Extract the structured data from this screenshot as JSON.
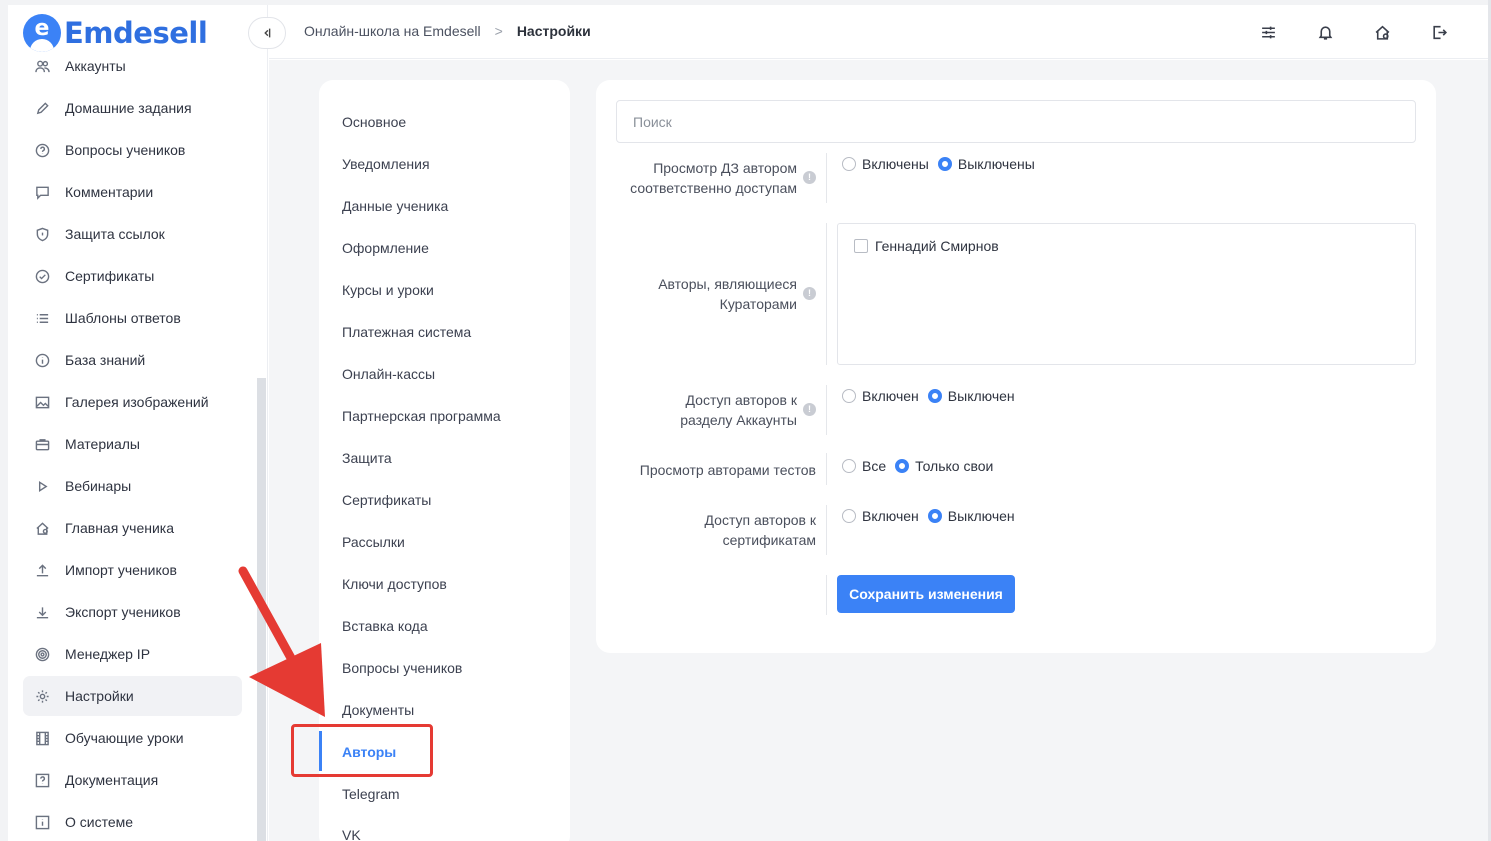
{
  "app": {
    "logo_text": "Emdesell"
  },
  "sidebar": {
    "items": [
      {
        "label": "Аккаунты",
        "icon": "users-icon"
      },
      {
        "label": "Домашние задания",
        "icon": "pencil-icon"
      },
      {
        "label": "Вопросы учеников",
        "icon": "question-circle-icon"
      },
      {
        "label": "Комментарии",
        "icon": "comment-icon"
      },
      {
        "label": "Защита ссылок",
        "icon": "shield-icon"
      },
      {
        "label": "Сертификаты",
        "icon": "check-circle-icon"
      },
      {
        "label": "Шаблоны ответов",
        "icon": "list-icon"
      },
      {
        "label": "База знаний",
        "icon": "info-circle-icon"
      },
      {
        "label": "Галерея изображений",
        "icon": "image-icon"
      },
      {
        "label": "Материалы",
        "icon": "briefcase-icon"
      },
      {
        "label": "Вебинары",
        "icon": "play-icon"
      },
      {
        "label": "Главная ученика",
        "icon": "home-icon"
      },
      {
        "label": "Импорт учеников",
        "icon": "upload-icon"
      },
      {
        "label": "Экспорт учеников",
        "icon": "download-icon"
      },
      {
        "label": "Менеджер IP",
        "icon": "target-icon"
      },
      {
        "label": "Настройки",
        "icon": "gear-icon",
        "active": true
      },
      {
        "label": "Обучающие уроки",
        "icon": "film-icon"
      },
      {
        "label": "Документация",
        "icon": "help-box-icon"
      },
      {
        "label": "О системе",
        "icon": "info-box-icon"
      }
    ]
  },
  "header": {
    "breadcrumb": {
      "root": "Онлайн-школа на Emdesell",
      "separator": ">",
      "current": "Настройки"
    },
    "icons": [
      "sliders-icon",
      "bell-icon",
      "home-settings-icon",
      "logout-icon"
    ]
  },
  "settings_menu": {
    "items": [
      "Основное",
      "Уведомления",
      "Данные ученика",
      "Оформление",
      "Курсы и уроки",
      "Платежная система",
      "Онлайн-кассы",
      "Партнерская программа",
      "Защита",
      "Сертификаты",
      "Рассылки",
      "Ключи доступов",
      "Вставка кода",
      "Вопросы учеников",
      "Документы",
      "Авторы",
      "Telegram",
      "VK"
    ],
    "active": "Авторы"
  },
  "form": {
    "search_placeholder": "Поиск",
    "hw_view": {
      "label_line1": "Просмотр ДЗ автором",
      "label_line2": "соответственно доступам",
      "options": [
        "Включены",
        "Выключены"
      ],
      "selected": "Выключены"
    },
    "curator_authors": {
      "label_line1": "Авторы, являющиеся",
      "label_line2": "Кураторами",
      "authors": [
        {
          "name": "Геннадий Смирнов",
          "checked": false
        }
      ]
    },
    "accounts_access": {
      "label_line1": "Доступ авторов к",
      "label_line2": "разделу Аккаунты",
      "options": [
        "Включен",
        "Выключен"
      ],
      "selected": "Выключен"
    },
    "tests_view": {
      "label": "Просмотр авторами тестов",
      "options": [
        "Все",
        "Только свои"
      ],
      "selected": "Только свои"
    },
    "cert_access": {
      "label_line1": "Доступ авторов к",
      "label_line2": "сертификатам",
      "options": [
        "Включен",
        "Выключен"
      ],
      "selected": "Выключен"
    },
    "save_label": "Сохранить изменения",
    "info_glyph": "!"
  },
  "annotation": {
    "color": "#e53a33"
  },
  "colors": {
    "accent": "#3b82f6",
    "brand": "#2f6fe0"
  }
}
